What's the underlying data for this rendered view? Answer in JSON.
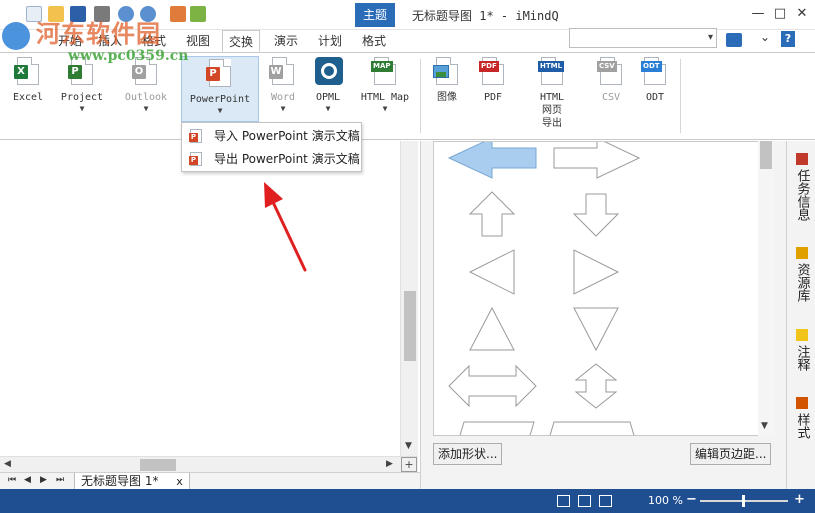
{
  "title_bar": {
    "context_tab": "主题",
    "window_title": "无标题导图 1* - iMindQ",
    "minimize": "—",
    "maximize": "□",
    "close": "✕",
    "help": "?"
  },
  "tabs": [
    {
      "label": "文件"
    },
    {
      "label": "开始"
    },
    {
      "label": "插入"
    },
    {
      "label": "格式"
    },
    {
      "label": "视图"
    },
    {
      "label": "交换"
    },
    {
      "label": "演示"
    },
    {
      "label": "计划"
    },
    {
      "label": "格式"
    }
  ],
  "ribbon": {
    "import_group": [
      {
        "label": "Excel",
        "icon": "excel-icon",
        "badge": "X",
        "color": "#1f7a3a"
      },
      {
        "label": "Project",
        "icon": "project-icon",
        "badge": "P",
        "color": "#2e7d32"
      },
      {
        "label": "Outlook",
        "icon": "outlook-icon",
        "badge": "O",
        "color": "#a0a0a0"
      },
      {
        "label": "PowerPoint",
        "icon": "powerpoint-icon",
        "badge": "P",
        "color": "#d24726"
      },
      {
        "label": "Word",
        "icon": "word-icon",
        "badge": "W",
        "color": "#a0a0a0"
      },
      {
        "label": "OPML",
        "icon": "opml-icon"
      },
      {
        "label": "HTML Map",
        "icon": "html-map-icon",
        "badge": "MAP",
        "color": "#2e7d32"
      }
    ],
    "export_group": [
      {
        "label": "图像",
        "icon": "image-icon"
      },
      {
        "label": "PDF",
        "icon": "pdf-icon",
        "badge": "PDF",
        "color": "#c62828"
      },
      {
        "label": "HTML\n网页\n导出",
        "icon": "html-icon",
        "badge": "HTML",
        "color": "#1f5da8"
      },
      {
        "label": "CSV",
        "icon": "csv-icon",
        "badge": "CSV",
        "color": "#a0a0a0"
      },
      {
        "label": "ODT",
        "icon": "odt-icon",
        "badge": "ODT",
        "color": "#2a7fd4"
      }
    ]
  },
  "dropdown_menu": {
    "items": [
      {
        "label": "导入 PowerPoint 演示文稿",
        "icon": "powerpoint-small-icon"
      },
      {
        "label": "导出 PowerPoint 演示文稿",
        "icon": "powerpoint-small-icon"
      }
    ]
  },
  "shape_panel": {
    "add_shape_button": "添加形状...",
    "edit_margin_button": "编辑页边距..."
  },
  "side_tabs": [
    {
      "label": "任务信息",
      "icon": "task-icon",
      "color": "#c0392b"
    },
    {
      "label": "资源库",
      "icon": "resource-icon",
      "color": "#e0a100"
    },
    {
      "label": "注释",
      "icon": "note-icon",
      "color": "#f0c419"
    },
    {
      "label": "样式",
      "icon": "style-icon",
      "color": "#d35400"
    }
  ],
  "document_tab": {
    "label": "无标题导图 1*",
    "close": "x"
  },
  "status_bar": {
    "zoom": "100 %",
    "zoom_minus": "−",
    "zoom_plus": "+"
  },
  "watermark": {
    "text": "河东软件园",
    "url": "www.pc0359.cn"
  },
  "colors": {
    "accent": "#2b6cb8",
    "status_bar": "#1f4e91",
    "selected": "#dbe9f7"
  }
}
